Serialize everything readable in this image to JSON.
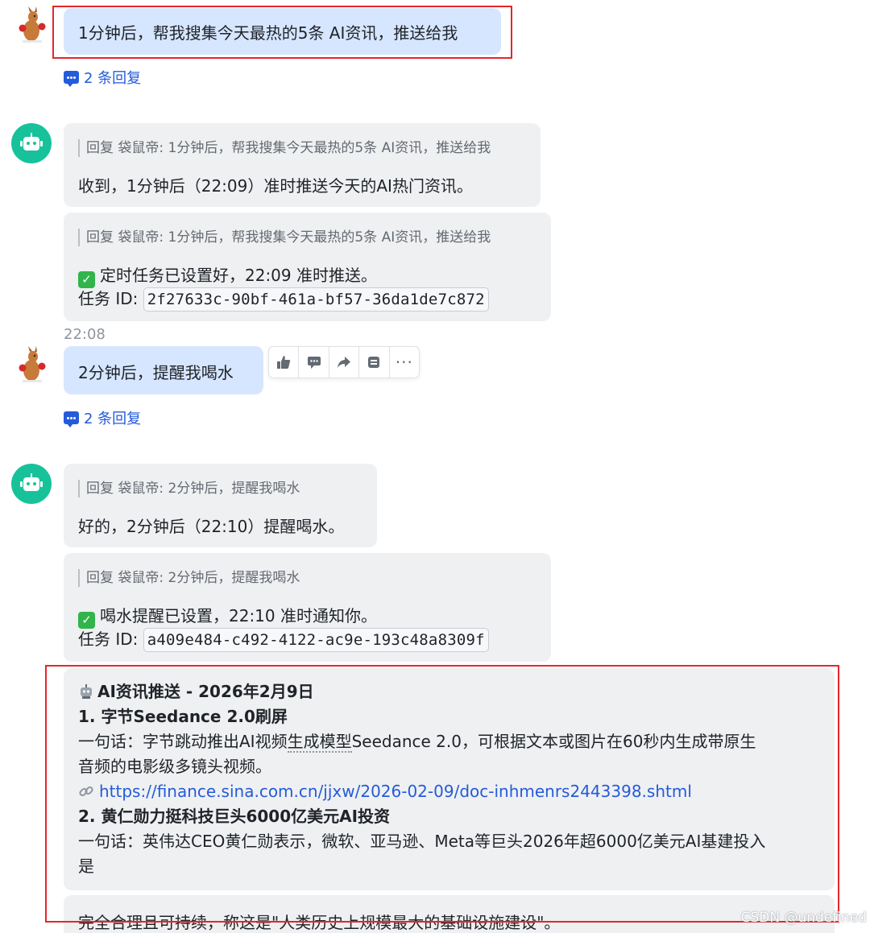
{
  "messages": {
    "m1": {
      "text": "1分钟后，帮我搜集今天最热的5条 AI资讯，推送给我",
      "reply_count": "2 条回复"
    },
    "m2": {
      "quote": "回复 袋鼠帝: 1分钟后，帮我搜集今天最热的5条 AI资讯，推送给我",
      "text": "收到，1分钟后（22:09）准时推送今天的AI热门资讯。"
    },
    "m3": {
      "quote": "回复 袋鼠帝: 1分钟后，帮我搜集今天最热的5条 AI资讯，推送给我",
      "line1": "定时任务已设置好，22:09 准时推送。",
      "id_label": "任务 ID:",
      "task_id": "2f27633c-90bf-461a-bf57-36da1de7c872"
    },
    "timestamp": "22:08",
    "m4": {
      "text": "2分钟后，提醒我喝水",
      "reply_count": "2 条回复"
    },
    "m5": {
      "quote": "回复 袋鼠帝: 2分钟后，提醒我喝水",
      "text": "好的，2分钟后（22:10）提醒喝水。"
    },
    "m6": {
      "quote": "回复 袋鼠帝: 2分钟后，提醒我喝水",
      "line1": "喝水提醒已设置，22:10 准时通知你。",
      "id_label": "任务 ID:",
      "task_id": "a409e484-c492-4122-ac9e-193c48a8309f"
    },
    "m7": {
      "title": "AI资讯推送 - 2026年2月9日",
      "item1_title": "1. 字节Seedance 2.0刷屏",
      "item1_desc_a": "一句话：字节跳动推出AI视频",
      "item1_desc_b": "生成模型",
      "item1_desc_c": "Seedance 2.0，可根据文本或图片在60秒内生成带原生",
      "item1_desc_d": "音频的电影级多镜头视频。",
      "item1_link": "https://finance.sina.com.cn/jjxw/2026-02-09/doc-inhmenrs2443398.shtml",
      "item2_title": "2. 黄仁勋力挺科技巨头6000亿美元AI投资",
      "item2_desc_a": "一句话：英伟达CEO黄仁勋表示，微软、亚马逊、Meta等巨头2026年超6000亿美元AI基建投入",
      "item2_desc_b": "是"
    },
    "m8": {
      "text": "完全合理且可持续，称这是\"人类历史上规模最大的基础设施建设\"。"
    }
  },
  "watermark": "CSDN @undefined",
  "colors": {
    "self_bubble": "#d6e6ff",
    "other_bubble": "#eff0f1",
    "bot_avatar": "#17c29b",
    "link": "#245bdb",
    "highlight_box": "#e5262a"
  },
  "icons": [
    "kangaroo-avatar-icon",
    "robot-avatar-icon",
    "reply-thread-icon",
    "check-icon",
    "thumbs-up-icon",
    "comment-icon",
    "forward-icon",
    "pin-icon",
    "more-icon",
    "robot-emoji-icon",
    "link-icon"
  ]
}
